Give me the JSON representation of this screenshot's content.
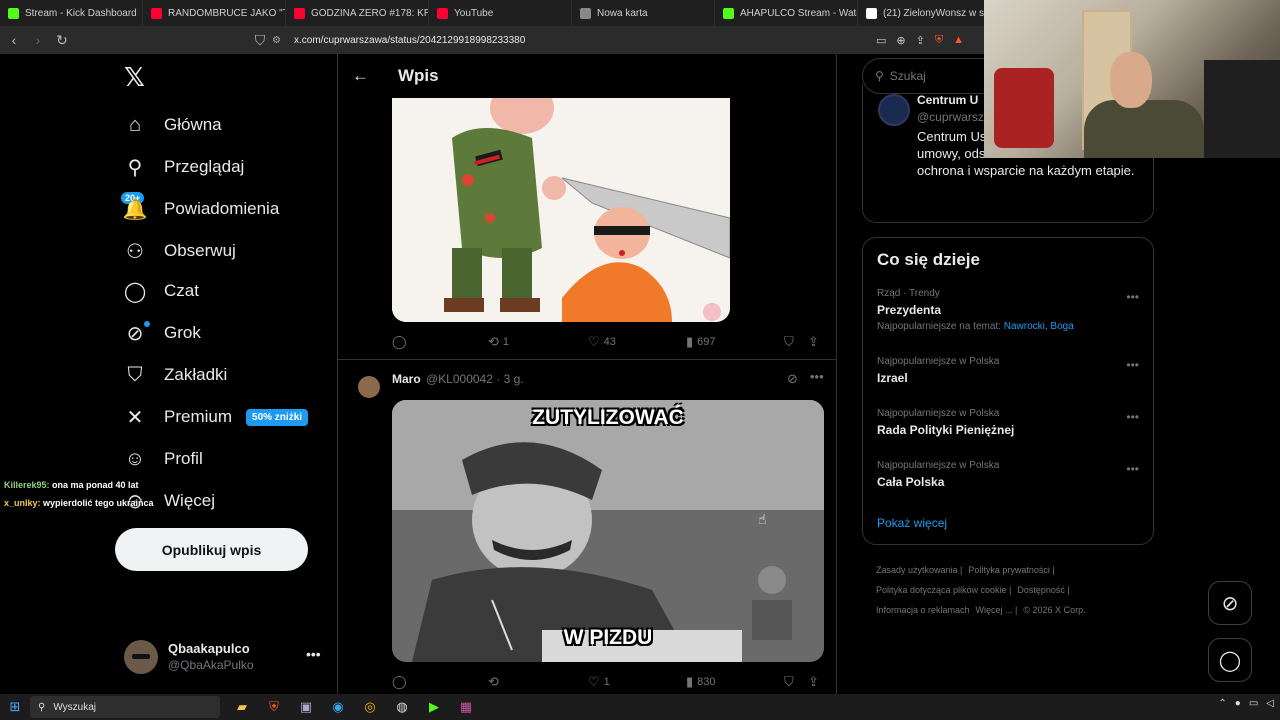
{
  "browser": {
    "tabs": [
      {
        "label": "Stream - Kick Dashboard",
        "color": "#53fc18"
      },
      {
        "label": "RANDOMBRUCE JAKO \"TOP 1\"",
        "color": "#ff0033"
      },
      {
        "label": "GODZINA ZERO #178: KRZYSZ",
        "color": "#ff0033"
      },
      {
        "label": "YouTube",
        "color": "#ff0033"
      },
      {
        "label": "Nowa karta",
        "color": "#888888"
      },
      {
        "label": "AHAPULCO Stream - Watch Liv",
        "color": "#53fc18"
      },
      {
        "label": "(21) ZielonyWonsz w serwisie",
        "color": "#ffffff"
      }
    ],
    "url": "x.com/cuprwarszawa/status/2042129918998233380"
  },
  "nav": {
    "items": [
      {
        "label": "Główna",
        "icon": "home-icon",
        "glyph": "⌂"
      },
      {
        "label": "Przeglądaj",
        "icon": "search-icon",
        "glyph": "⚲"
      },
      {
        "label": "Powiadomienia",
        "icon": "bell-icon",
        "glyph": "🔔"
      },
      {
        "label": "Obserwuj",
        "icon": "follow-icon",
        "glyph": "⚇"
      },
      {
        "label": "Czat",
        "icon": "chat-icon",
        "glyph": "◯"
      },
      {
        "label": "Grok",
        "icon": "grok-icon",
        "glyph": "⊘"
      },
      {
        "label": "Zakładki",
        "icon": "bookmark-icon",
        "glyph": "⛉"
      },
      {
        "label": "Premium",
        "icon": "x-premium-icon",
        "glyph": "✕"
      },
      {
        "label": "Profil",
        "icon": "profile-icon",
        "glyph": "☺"
      },
      {
        "label": "Więcej",
        "icon": "more-circle-icon",
        "glyph": "⊙"
      }
    ],
    "notif_badge": "20+",
    "premium_badge": "50% zniżki",
    "post_button": "Opublikuj wpis",
    "account": {
      "name": "Qbaakapulco",
      "handle": "@QbaAkaPulko"
    }
  },
  "chat_overlay": [
    {
      "user": "Killerek95:",
      "text": "ona ma ponad 40 lat"
    },
    {
      "user": "x_unlky:",
      "text": "wypierdolić tego ukraińca"
    }
  ],
  "main": {
    "header_title": "Wpis",
    "tweet1_stats": {
      "retweets": "1",
      "likes": "43",
      "views": "697"
    },
    "tweet2": {
      "name": "Maro",
      "handle_time": "@KL000042 · 3 g.",
      "caption_top": "ZUTYLIZOWAĆ",
      "caption_bottom": "W PIZDU",
      "likes": "1",
      "views": "830"
    }
  },
  "right": {
    "search_placeholder": "Szukaj",
    "profile_card": {
      "name": "Centrum U",
      "handle": "@cuprwarsz",
      "bio": "Centrum Us profesjonal i firm. Spory, umowy, odszkodowania. Skuteczna ochrona i wsparcie na każdym etapie."
    },
    "trends_title": "Co się dzieje",
    "trends": [
      {
        "context": "Rząd · Trendy",
        "name": "Prezydenta",
        "sub_prefix": "Najpopularniejsze na temat:",
        "sub_links": "Nawrocki, Boga"
      },
      {
        "context": "Najpopularniejsze w Polska",
        "name": "Izrael",
        "sub_prefix": "",
        "sub_links": ""
      },
      {
        "context": "Najpopularniejsze w Polska",
        "name": "Rada Polityki Pieniężnej",
        "sub_prefix": "",
        "sub_links": ""
      },
      {
        "context": "Najpopularniejsze w Polska",
        "name": "Cała Polska",
        "sub_prefix": "",
        "sub_links": ""
      }
    ],
    "show_more": "Pokaż więcej",
    "footer": [
      "Zasady użytkowania",
      "Polityka prywatności",
      "Polityka dotycząca plików cookie",
      "Dostępność",
      "Informacja o reklamach",
      "Więcej ...",
      "© 2026 X Corp."
    ]
  },
  "taskbar": {
    "search_label": "Wyszukaj"
  }
}
